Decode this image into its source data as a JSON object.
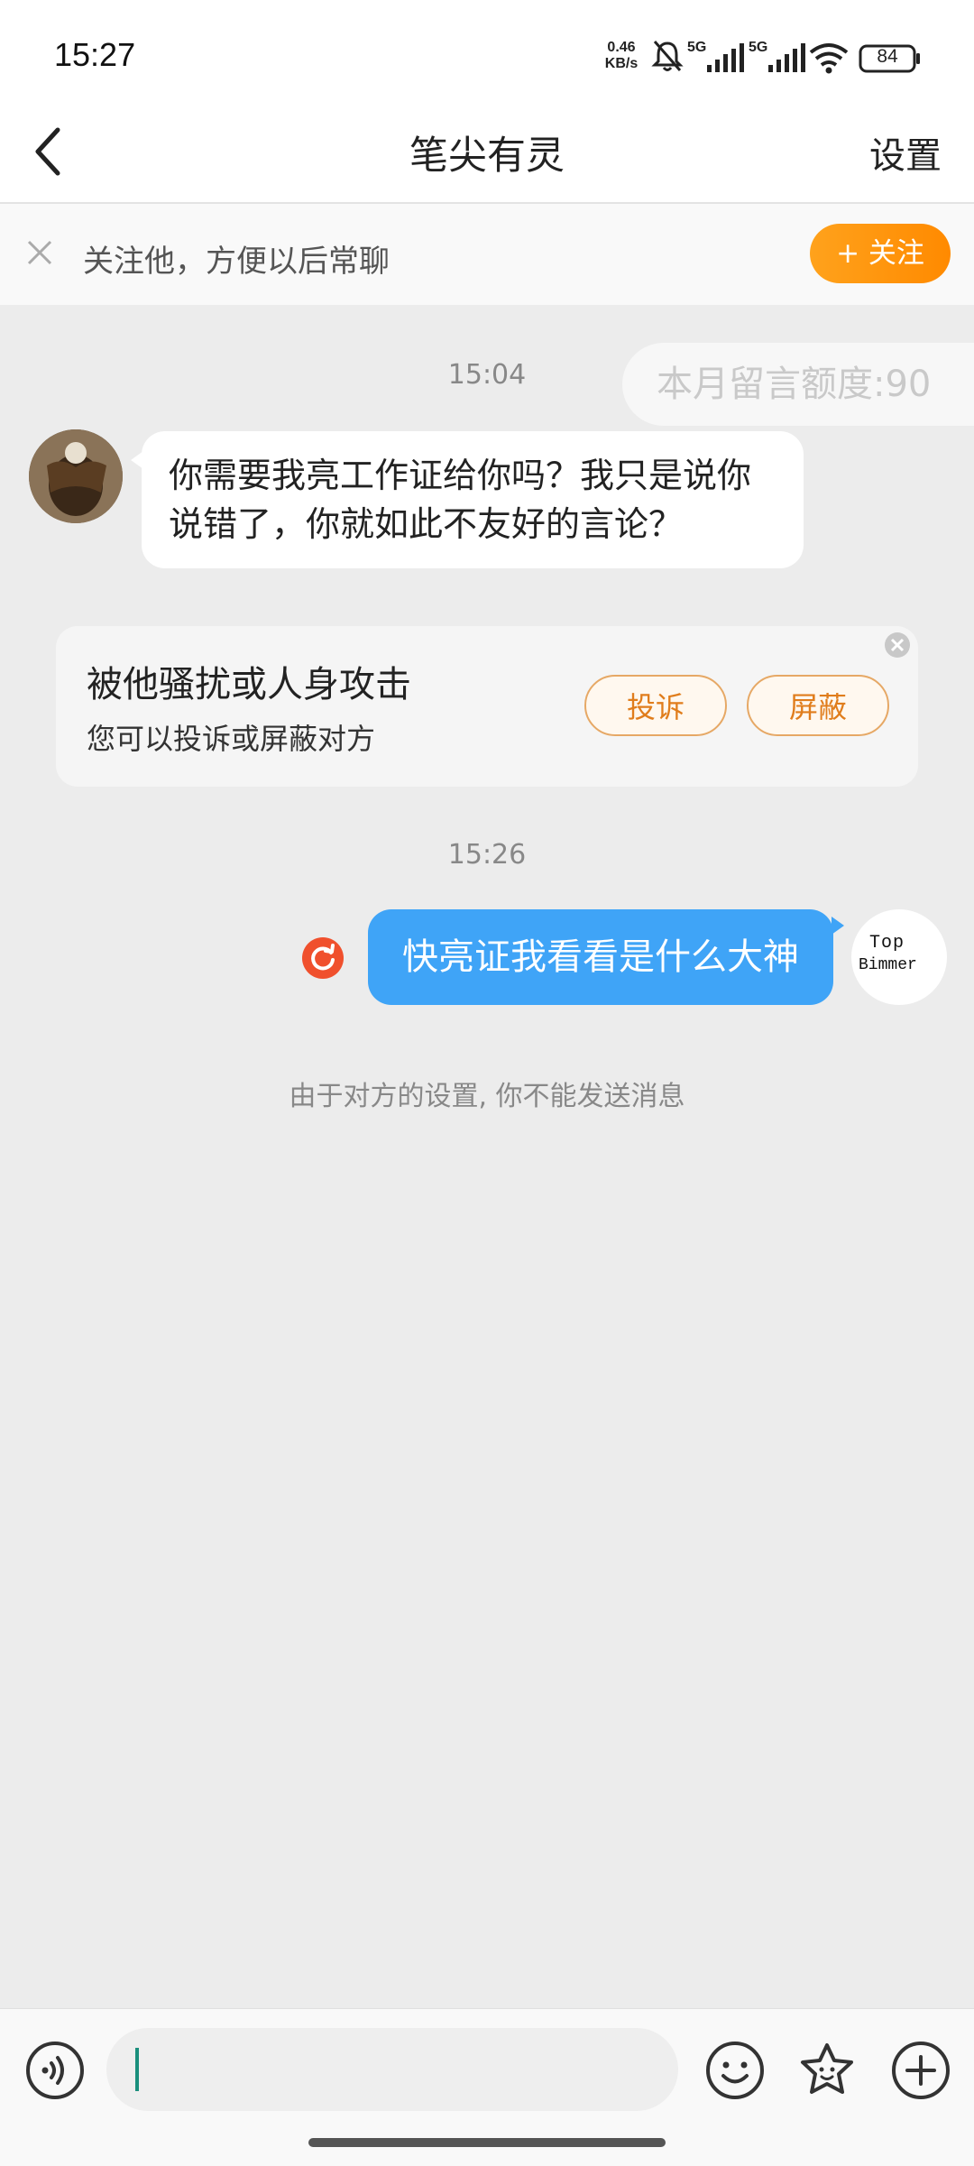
{
  "status_bar": {
    "time": "15:27",
    "net_speed_value": "0.46",
    "net_speed_unit": "KB/s",
    "signal_1_label": "5G",
    "signal_2_label": "5G",
    "battery": "84"
  },
  "header": {
    "title": "笔尖有灵",
    "settings_label": "设置"
  },
  "follow_bar": {
    "prompt": "关注他，方便以后常聊",
    "follow_button": "+ 关注"
  },
  "quota_badge": "本月留言额度:90",
  "messages": [
    {
      "timestamp": "15:04"
    },
    {
      "text": "你需要我亮工作证给你吗？我只是说你说错了，你就如此不友好的言论？"
    },
    {
      "timestamp": "15:26"
    },
    {
      "text": "快亮证我看看是什么大神"
    }
  ],
  "harassment_card": {
    "title": "被他骚扰或人身攻击",
    "subtitle": "您可以投诉或屏蔽对方",
    "complain_button": "投诉",
    "block_button": "屏蔽"
  },
  "right_avatar": {
    "line1": "Top",
    "line2": "Bimmer"
  },
  "notice": "由于对方的设置, 你不能发送消息",
  "colors": {
    "accent_orange": "#ff8a00",
    "bubble_blue": "#3fa4f7",
    "background": "#ececec"
  },
  "icons": [
    "back-icon",
    "close-icon",
    "retry-icon",
    "voice-icon",
    "emoji-icon",
    "sticker-icon",
    "add-icon"
  ]
}
